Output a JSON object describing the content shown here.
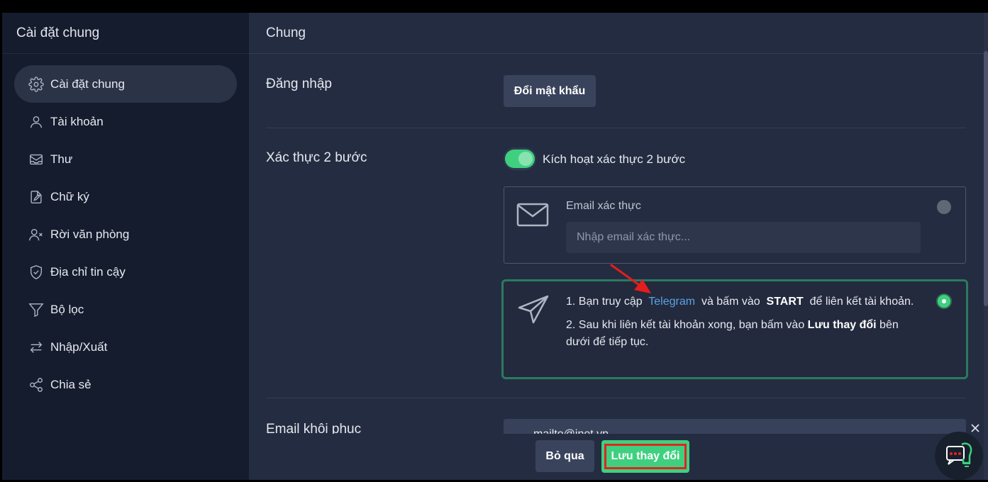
{
  "sidebar": {
    "title": "Cài đặt chung",
    "items": [
      {
        "label": "Cài đặt chung",
        "icon": "gear-icon",
        "active": true
      },
      {
        "label": "Tài khoản",
        "icon": "user-icon"
      },
      {
        "label": "Thư",
        "icon": "mail-tray-icon"
      },
      {
        "label": "Chữ ký",
        "icon": "signature-icon"
      },
      {
        "label": "Rời văn phòng",
        "icon": "user-x-icon"
      },
      {
        "label": "Địa chỉ tin cậy",
        "icon": "shield-check-icon"
      },
      {
        "label": "Bộ lọc",
        "icon": "filter-icon"
      },
      {
        "label": "Nhập/Xuất",
        "icon": "arrows-swap-icon"
      },
      {
        "label": "Chia sẻ",
        "icon": "share-icon"
      }
    ]
  },
  "main": {
    "title": "Chung",
    "login": {
      "label": "Đăng nhập",
      "change_password_label": "Đổi mật khẩu"
    },
    "two_factor": {
      "label": "Xác thực 2 bước",
      "toggle_label": "Kích hoạt xác thực 2 bước",
      "toggle_on": true,
      "email_option": {
        "title": "Email xác thực",
        "placeholder": "Nhập email xác thực...",
        "selected": false
      },
      "telegram_option": {
        "step1_prefix": "1. Bạn truy cập",
        "step1_link": "Telegram",
        "step1_middle": "và bấm vào",
        "step1_bold": "START",
        "step1_suffix": "để liên kết tài khoản.",
        "step2_prefix": "2. Sau khi liên kết tài khoản xong, bạn bấm vào",
        "step2_bold": "Lưu thay đổi",
        "step2_suffix": "bên dưới để tiếp tục.",
        "selected": true
      }
    },
    "recovery_email": {
      "label": "Email khôi phục",
      "value": "mailto@inet.vn"
    }
  },
  "footer": {
    "skip_label": "Bỏ qua",
    "save_label": "Lưu thay đổi"
  },
  "colors": {
    "sidebar_bg": "#151c2e",
    "main_bg": "#242c41",
    "accent_green": "#3fd07f",
    "link_blue": "#5aa2e6",
    "highlight_red": "#e02424"
  }
}
